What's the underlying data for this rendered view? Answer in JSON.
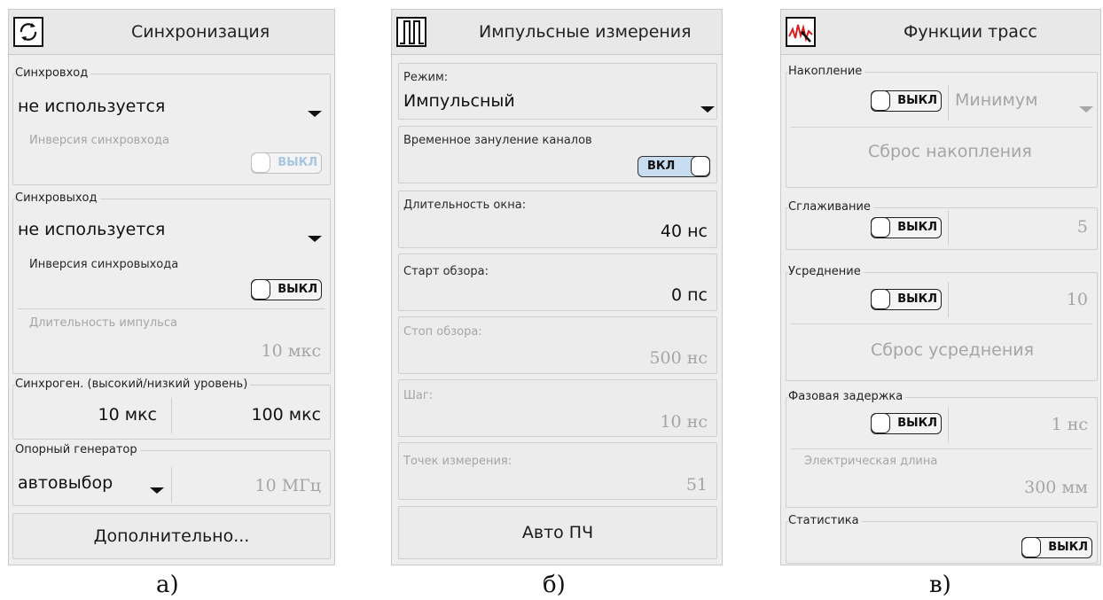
{
  "sync": {
    "title": "Синхронизация",
    "input_label": "Синхровход",
    "input_value": "не используется",
    "input_inversion_label": "Инверсия синхровхода",
    "input_inversion_state": "ВЫКЛ",
    "output_label": "Синхровыход",
    "output_value": "не используется",
    "output_inversion_label": "Инверсия синхровыхода",
    "output_inversion_state": "ВЫКЛ",
    "pulse_duration_label": "Длительность импульса",
    "pulse_duration_value": "10 мкс",
    "gen_label": "Синхроген. (высокий/низкий уровень)",
    "gen_high": "10 мкс",
    "gen_low": "100 мкс",
    "ref_label": "Опорный генератор",
    "ref_value": "автовыбор",
    "ref_freq": "10 МГц",
    "more_button": "Дополнительно...",
    "caption": "а)"
  },
  "pulse": {
    "title": "Импульсные измерения",
    "mode_label": "Режим:",
    "mode_value": "Импульсный",
    "zeroing_label": "Временное зануление каналов",
    "zeroing_state": "ВКЛ",
    "window_label": "Длительность окна:",
    "window_value": "40 нс",
    "start_label": "Старт обзора:",
    "start_value": "0 пс",
    "stop_label": "Стоп обзора:",
    "stop_value": "500 нс",
    "step_label": "Шаг:",
    "step_value": "10 нс",
    "points_label": "Точек измерения:",
    "points_value": "51",
    "auto_button": "Авто ПЧ",
    "caption": "б)"
  },
  "trace": {
    "title": "Функции трасс",
    "accum_label": "Накопление",
    "accum_state": "ВЫКЛ",
    "accum_mode": "Минимум",
    "accum_reset": "Сброс накопления",
    "smooth_label": "Сглаживание",
    "smooth_state": "ВЫКЛ",
    "smooth_value": "5",
    "avg_label": "Усреднение",
    "avg_state": "ВЫКЛ",
    "avg_value": "10",
    "avg_reset": "Сброс усреднения",
    "phase_label": "Фазовая задержка",
    "phase_state": "ВЫКЛ",
    "phase_value": "1 нс",
    "elec_label": "Электрическая длина",
    "elec_value": "300 мм",
    "stats_label": "Статистика",
    "stats_state": "ВЫКЛ",
    "caption": "в)"
  },
  "icons": {
    "sync": "refresh-icon",
    "pulse": "pulse-icon",
    "trace": "trace-signal-icon"
  },
  "colors": {
    "on_toggle": "#c9ddf0",
    "disabled_text": "#a5a5a5",
    "trace_icon": "#d42020"
  }
}
